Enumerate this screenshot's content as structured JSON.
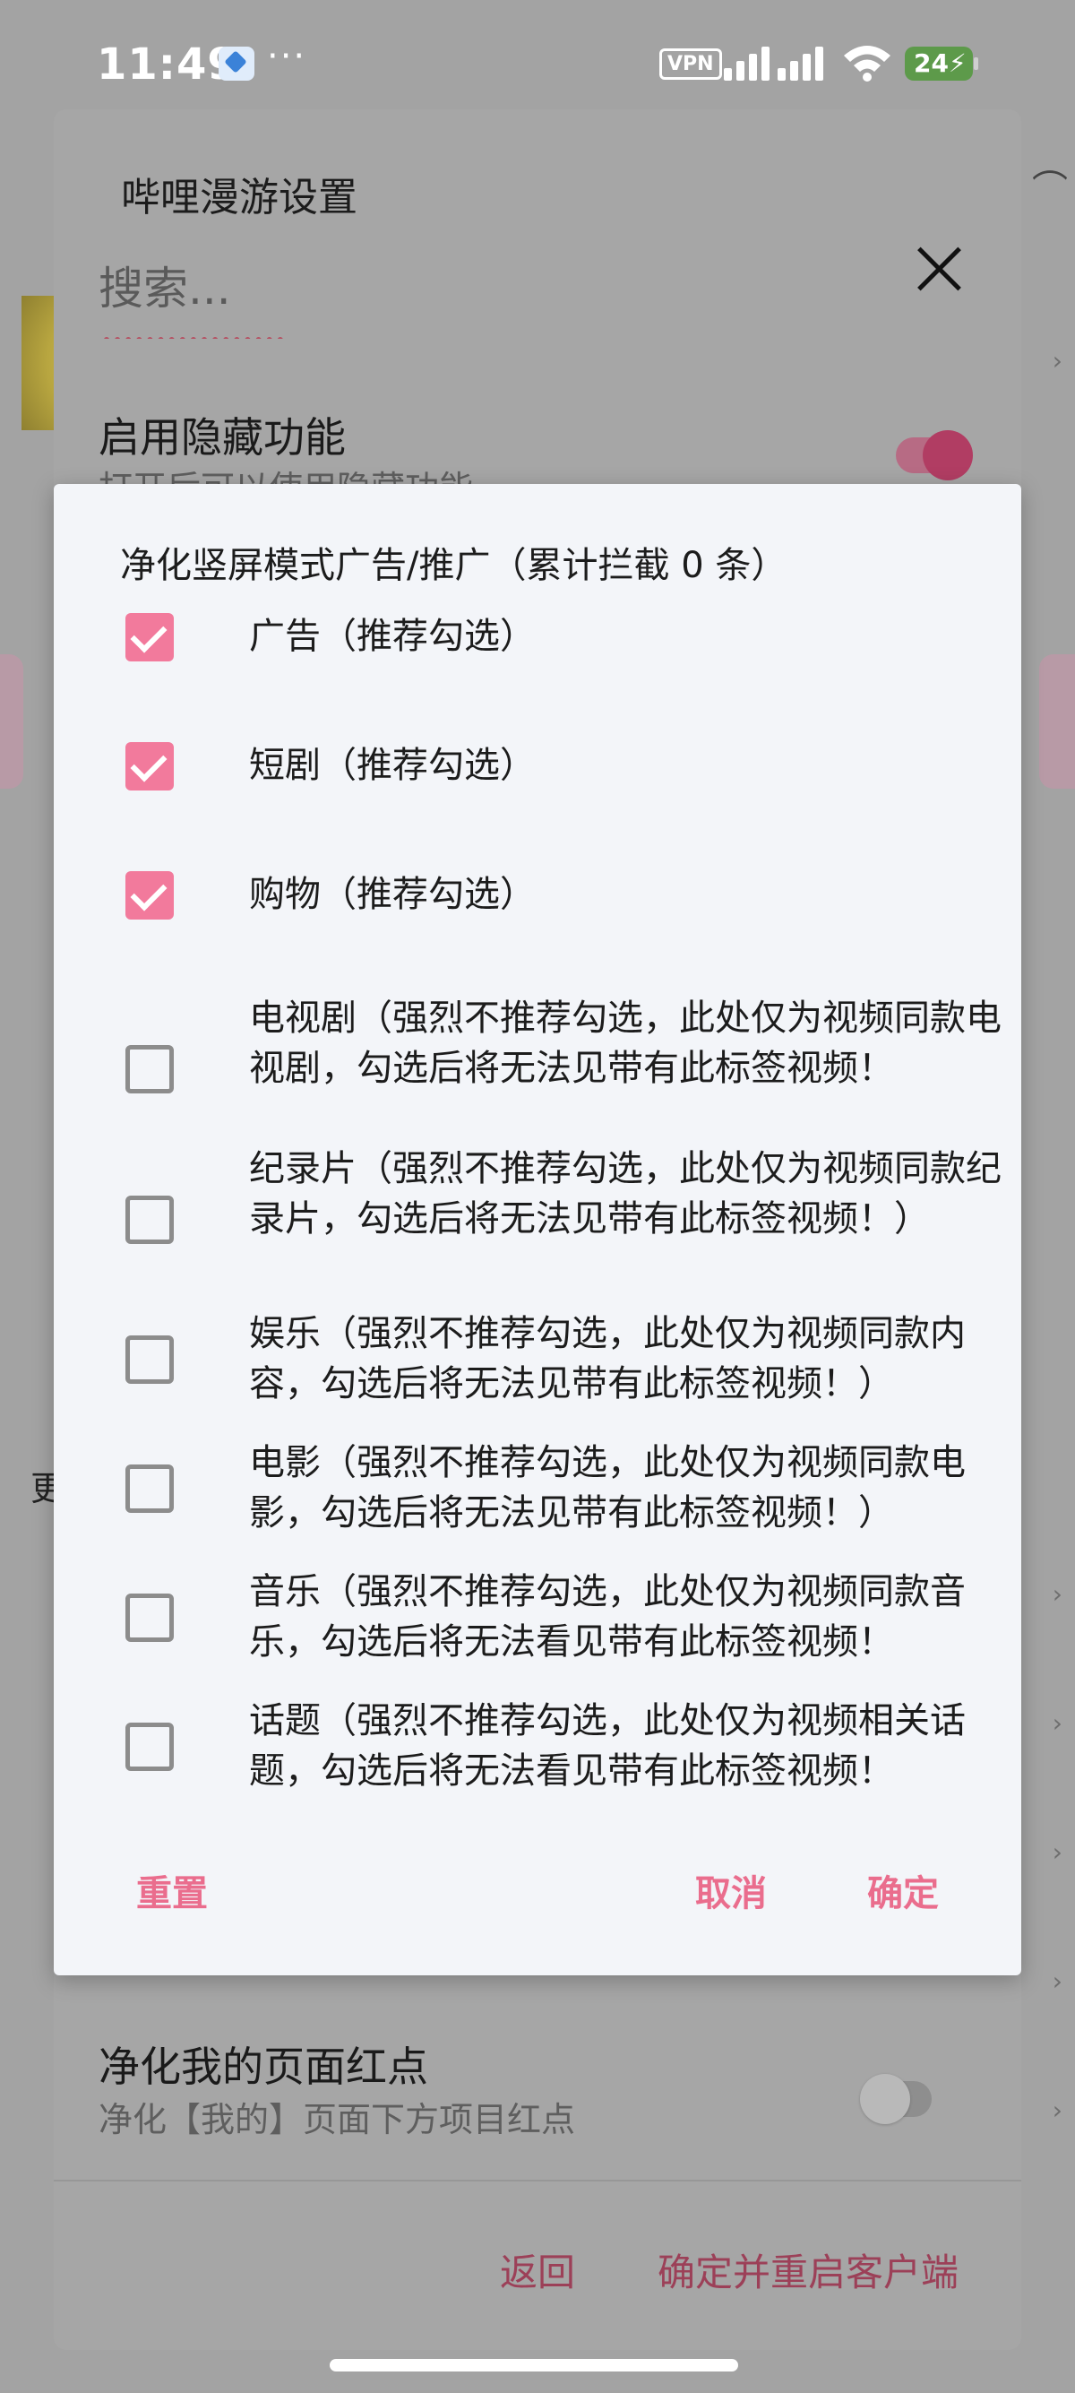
{
  "status_bar": {
    "time": "11:49",
    "more": "···",
    "vpn": "VPN",
    "battery": "24"
  },
  "settings_sheet": {
    "title": "哔哩漫游设置",
    "search_placeholder": "搜索...",
    "row_hide": {
      "title": "启用隐藏功能",
      "subtitle": "打开后可以使用隐藏功能",
      "enabled": true
    },
    "row_red_dot": {
      "title": "净化我的页面红点",
      "subtitle": "净化【我的】页面下方项目红点",
      "enabled": false
    },
    "back_label": "返回",
    "confirm_restart_label": "确定并重启客户端"
  },
  "background": {
    "partial_letter": "更"
  },
  "dialog": {
    "title": "净化竖屏模式广告/推广（累计拦截 0 条）",
    "options": [
      {
        "label": "广告（推荐勾选）",
        "checked": true
      },
      {
        "label": "短剧（推荐勾选）",
        "checked": true
      },
      {
        "label": "购物（推荐勾选）",
        "checked": true
      },
      {
        "label": "电视剧（强烈不推荐勾选，此处仅为视频同款电视剧，勾选后将无法见带有此标签视频！",
        "checked": false
      },
      {
        "label": "纪录片（强烈不推荐勾选，此处仅为视频同款纪录片，勾选后将无法见带有此标签视频！）",
        "checked": false
      },
      {
        "label": "娱乐（强烈不推荐勾选，此处仅为视频同款内容，勾选后将无法见带有此标签视频！）",
        "checked": false
      },
      {
        "label": "电影（强烈不推荐勾选，此处仅为视频同款电影，勾选后将无法见带有此标签视频！）",
        "checked": false
      },
      {
        "label": "音乐（强烈不推荐勾选，此处仅为视频同款音乐，勾选后将无法看见带有此标签视频！",
        "checked": false
      },
      {
        "label": "话题（强烈不推荐勾选，此处仅为视频相关话题，勾选后将无法看见带有此标签视频！",
        "checked": false
      }
    ],
    "reset_label": "重置",
    "cancel_label": "取消",
    "ok_label": "确定"
  },
  "colors": {
    "accent": "#f27a9c",
    "button_text": "#ea6d8d",
    "dialog_bg": "#f3f5f9"
  }
}
